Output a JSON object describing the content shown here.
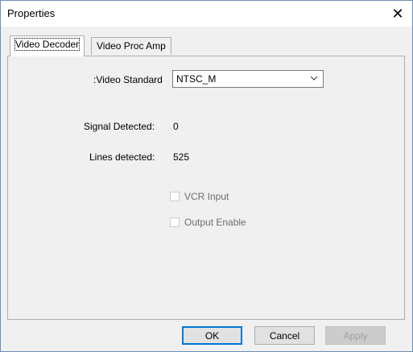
{
  "window": {
    "title": "Properties",
    "close_glyph": "✕"
  },
  "tabs": [
    {
      "label": "Video Decoder",
      "active": true
    },
    {
      "label": "Video Proc Amp",
      "active": false
    }
  ],
  "decoder": {
    "video_standard_label": ":Video Standard",
    "video_standard_value": "NTSC_M",
    "signal_detected_label": "Signal Detected:",
    "signal_detected_value": "0",
    "lines_detected_label": "Lines detected:",
    "lines_detected_value": "525",
    "vcr_input_label": "VCR Input",
    "vcr_input_checked": false,
    "output_enable_label": "Output Enable",
    "output_enable_checked": false
  },
  "buttons": {
    "ok": "OK",
    "cancel": "Cancel",
    "apply": "Apply"
  },
  "colors": {
    "accent": "#0078d7",
    "disabled_text": "#6d6d6d"
  }
}
